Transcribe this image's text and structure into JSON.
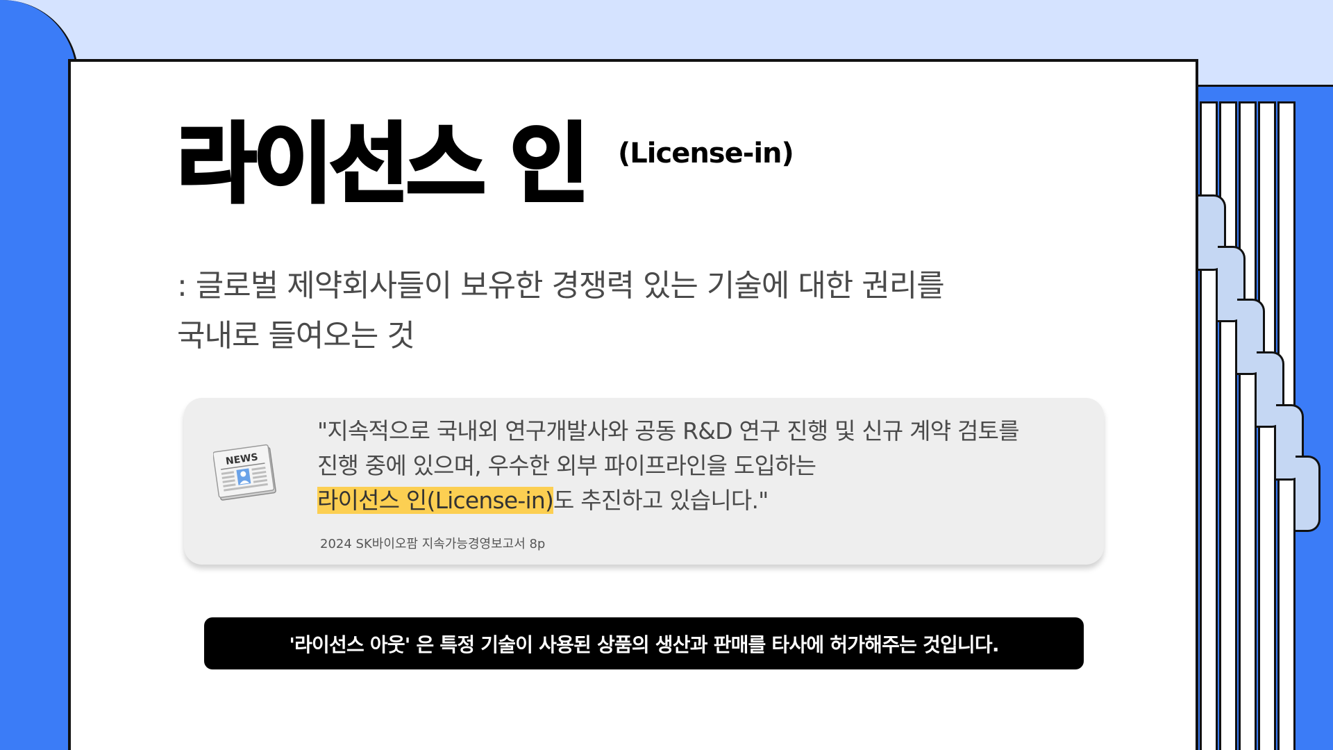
{
  "slide": {
    "title": "라이선스 인",
    "subtitle": "(License-in)",
    "definition_line1": ": 글로벌 제약회사들이 보유한 경쟁력 있는 기술에 대한 권리를",
    "definition_line2": "국내로 들여오는 것"
  },
  "quote": {
    "line1": "\"지속적으로 국내외 연구개발사와 공동 R&D 연구 진행 및 신규 계약 검토를",
    "line2": "진행 중에 있으며, 우수한 외부 파이프라인을 도입하는",
    "highlight": "라이선스 인(License-in)",
    "line3_rest": "도 추진하고 있습니다.\"",
    "source": "2024 SK바이오팜 지속가능경영보고서 8p",
    "icon_label": "NEWS",
    "icon": "newspaper-icon"
  },
  "note": {
    "text": "'라이선스 아웃' 은 특정 기술이 사용된 상품의 생산과 판매를 타사에 허가해주는 것입니다."
  },
  "colors": {
    "accent_blue": "#3b7cf7",
    "light_blue": "#d5e3ff",
    "tab_blue": "#c5d7f3",
    "highlight": "#fccf52"
  }
}
